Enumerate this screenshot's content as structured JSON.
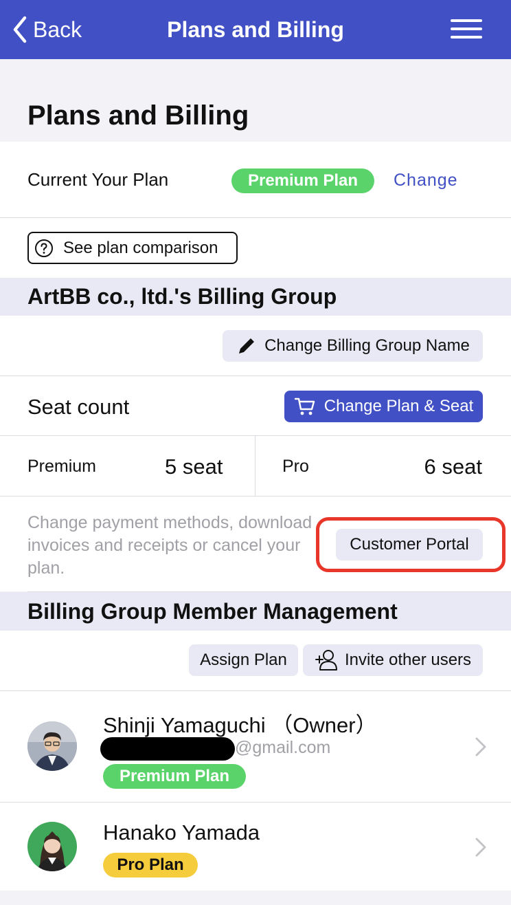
{
  "navbar": {
    "back_label": "Back",
    "title": "Plans and Billing"
  },
  "page": {
    "title": "Plans and Billing"
  },
  "current_plan": {
    "label": "Current Your Plan",
    "plan_badge": "Premium Plan",
    "change_link": "Change",
    "comparison_button": "See plan comparison"
  },
  "billing_group": {
    "title": "ArtBB co., ltd.'s Billing Group",
    "rename_button": "Change Billing Group Name",
    "seat_count_label": "Seat count",
    "change_plan_button": "Change Plan & Seat",
    "seats": [
      {
        "plan": "Premium",
        "count": "5 seat"
      },
      {
        "plan": "Pro",
        "count": "6 seat"
      }
    ],
    "portal_description": "Change payment methods, download invoices and receipts or cancel your plan.",
    "portal_button": "Customer Portal"
  },
  "members": {
    "title": "Billing Group Member Management",
    "assign_button": "Assign Plan",
    "invite_button": "Invite other users",
    "list": [
      {
        "name": "Shinji Yamaguchi （Owner）",
        "email_suffix": "@gmail.com",
        "plan": "Premium Plan"
      },
      {
        "name": "Hanako Yamada",
        "plan": "Pro Plan"
      }
    ]
  },
  "colors": {
    "navbar": "#4150c4",
    "premium_badge": "#5ad46a",
    "pro_badge": "#f5cd3c",
    "section_header": "#e8e9f4",
    "highlight": "#e8372a"
  }
}
